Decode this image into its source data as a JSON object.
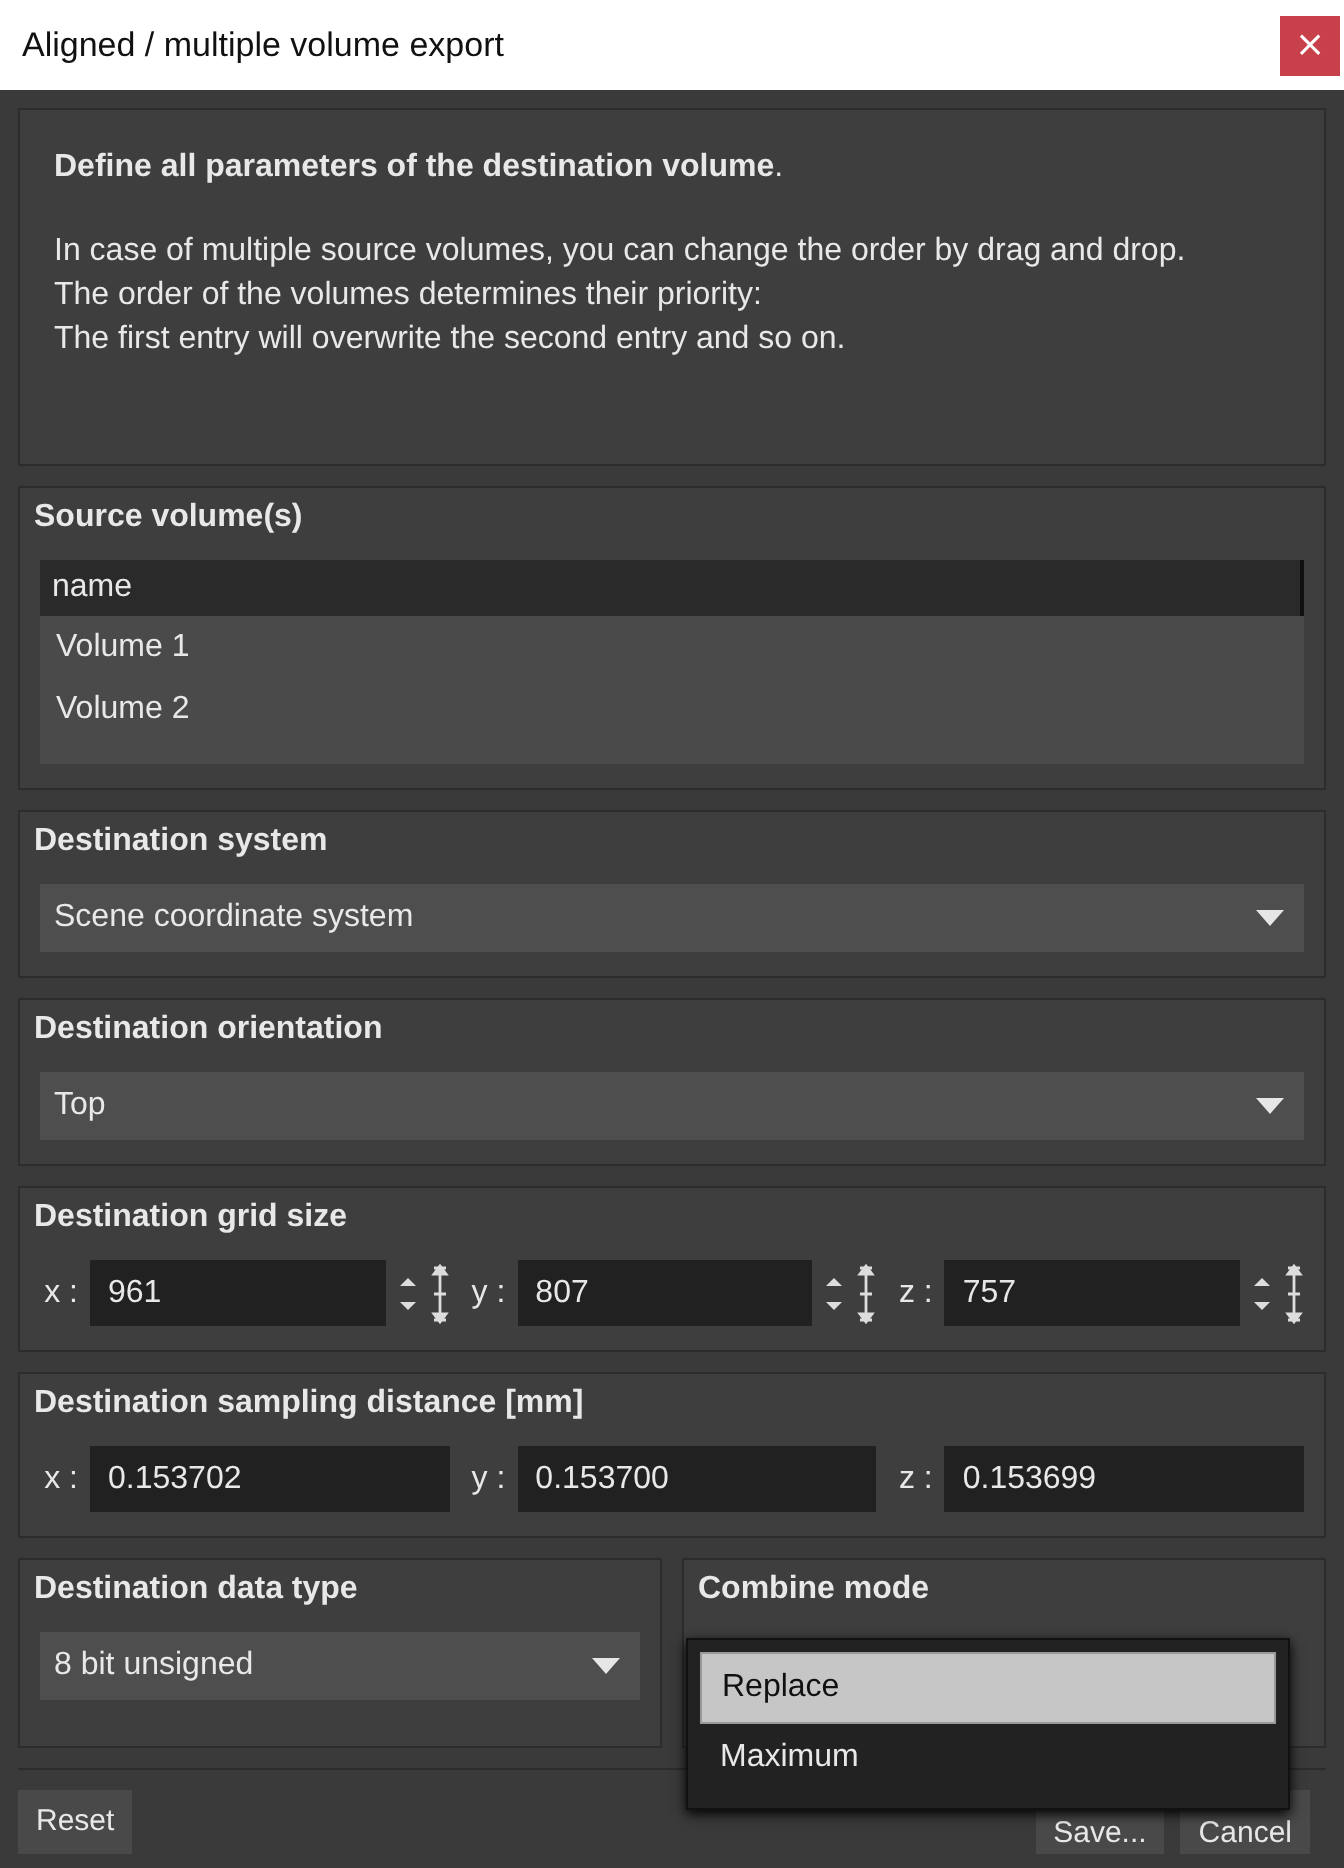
{
  "window": {
    "title": "Aligned / multiple volume export",
    "close": "×"
  },
  "intro": {
    "heading": "**Define all parameters of the destination volume**.",
    "lines": [
      "In case of multiple source volumes, you can change the order by drag and drop.",
      "The order of the volumes determines their priority:",
      "The first entry will overwrite the second entry and so on."
    ]
  },
  "source_volumes": {
    "title": "Source volume(s)",
    "column": "name",
    "rows": [
      "Volume 1",
      "Volume 2"
    ]
  },
  "destination_system": {
    "title": "Destination system",
    "value": "Scene coordinate system"
  },
  "destination_orientation": {
    "title": "Destination orientation",
    "value": "Top"
  },
  "grid_size": {
    "title": "Destination grid size",
    "spinner": true,
    "fields": [
      {
        "axis": "x :",
        "value": "961"
      },
      {
        "axis": "y :",
        "value": "807"
      },
      {
        "axis": "z :",
        "value": "757"
      }
    ]
  },
  "sampling_distance": {
    "title": "Destination sampling distance [mm]",
    "spinner": false,
    "fields": [
      {
        "axis": "x :",
        "value": "0.153702"
      },
      {
        "axis": "y :",
        "value": "0.153700"
      },
      {
        "axis": "z :",
        "value": "0.153699"
      }
    ]
  },
  "data_type": {
    "title": "Destination data type",
    "value": "8 bit unsigned"
  },
  "combine_mode": {
    "title": "Combine mode",
    "options": [
      {
        "label": "Replace",
        "selected": true
      },
      {
        "label": "Maximum",
        "selected": false
      }
    ]
  },
  "buttons": [
    {
      "label": "Reset"
    },
    {
      "label": "Save..."
    },
    {
      "label": "Cancel"
    }
  ]
}
